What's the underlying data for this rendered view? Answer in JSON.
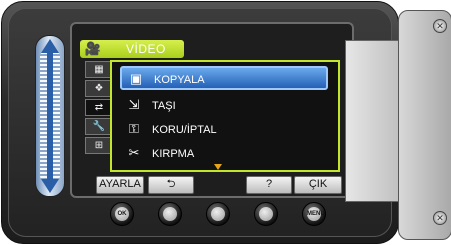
{
  "screen": {
    "header": {
      "icon": "video-camera-icon",
      "title": "VİDEO"
    },
    "side_tabs": [
      {
        "icon": "grid-icon"
      },
      {
        "icon": "scenes-icon"
      },
      {
        "icon": "copy-tab-icon"
      },
      {
        "icon": "wrench-icon"
      },
      {
        "icon": "plus-box-icon"
      }
    ],
    "menu": [
      {
        "icon": "copy-icon",
        "label": "KOPYALA",
        "selected": true
      },
      {
        "icon": "move-icon",
        "label": "TAŞI",
        "selected": false
      },
      {
        "icon": "key-icon",
        "label": "KORU/İPTAL",
        "selected": false
      },
      {
        "icon": "trim-icon",
        "label": "KIRPMA",
        "selected": false
      }
    ],
    "softkeys": {
      "set": "AYARLA",
      "back": "⮌",
      "help": "?",
      "exit": "ÇIK"
    }
  },
  "hardware": {
    "ok": "OK",
    "menu": "MENU"
  },
  "colors": {
    "header_green": "#c2e62a",
    "selection_blue": "#2460b6",
    "scroll_arrow": "#e6a417"
  }
}
